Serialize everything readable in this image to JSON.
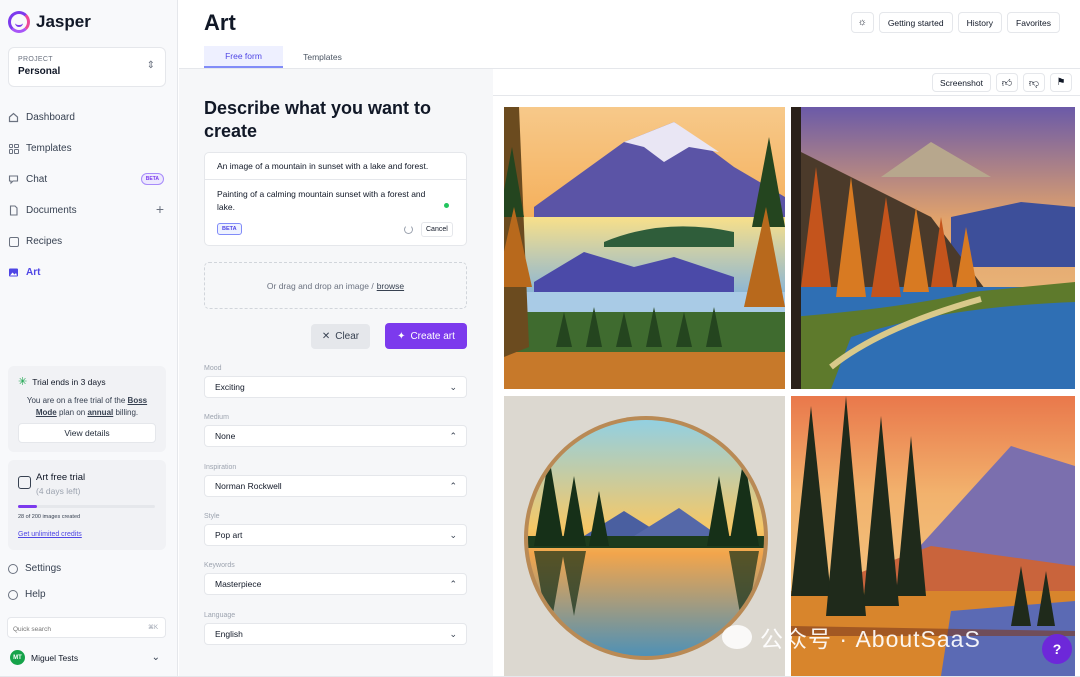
{
  "app": {
    "name": "Jasper"
  },
  "project": {
    "label": "PROJECT",
    "name": "Personal"
  },
  "nav": [
    {
      "label": "Dashboard",
      "icon": "home-icon"
    },
    {
      "label": "Templates",
      "icon": "grid-icon"
    },
    {
      "label": "Chat",
      "icon": "chat-icon",
      "badge": "BETA"
    },
    {
      "label": "Documents",
      "icon": "document-icon"
    },
    {
      "label": "Recipes",
      "icon": "recipe-icon"
    },
    {
      "label": "Art",
      "icon": "image-icon",
      "active": true
    }
  ],
  "trial": {
    "title": "Trial ends in 3 days",
    "text_before": "You are on a free trial of the ",
    "plan": "Boss Mode",
    "text_mid": " plan on ",
    "billing": "annual",
    "text_after": " billing.",
    "button": "View details"
  },
  "art_trial": {
    "title": "Art free trial",
    "subtitle": "(4 days left)",
    "count": "28 of 200 images created",
    "progress": 0.14,
    "link": "Get unlimited credits"
  },
  "bottom_nav": {
    "settings": "Settings",
    "help": "Help"
  },
  "quick_search": {
    "placeholder": "Quick search",
    "shortcut": "⌘K"
  },
  "user": {
    "initials": "MT",
    "name": "Miguel Tests"
  },
  "header": {
    "title": "Art",
    "buttons": [
      "Getting started",
      "History",
      "Favorites"
    ]
  },
  "tabs": [
    {
      "label": "Free form",
      "active": true
    },
    {
      "label": "Templates",
      "active": false
    }
  ],
  "form": {
    "title": "Describe what you want to create",
    "prompt_original": "An image of a mountain in sunset with a lake and forest.",
    "prompt_enhanced": "Painting of a calming mountain sunset with a forest and lake.",
    "beta_tag": "BETA",
    "cancel": "Cancel",
    "drop_text": "Or drag and drop an image /",
    "browse": "browse",
    "clear": "Clear",
    "create": "Create art",
    "fields": [
      {
        "label": "Mood",
        "value": "Exciting",
        "chevron": "down"
      },
      {
        "label": "Medium",
        "value": "None",
        "chevron": "up"
      },
      {
        "label": "Inspiration",
        "value": "Norman Rockwell",
        "chevron": "up"
      },
      {
        "label": "Style",
        "value": "Pop art",
        "chevron": "down"
      },
      {
        "label": "Keywords",
        "value": "Masterpiece",
        "chevron": "up"
      },
      {
        "label": "Language",
        "value": "English",
        "chevron": "down"
      }
    ]
  },
  "results": {
    "screenshot": "Screenshot"
  },
  "watermark": "公众号 · AboutSaaS",
  "help_bubble": "?",
  "colors": {
    "accent": "#7c3aed",
    "active_nav": "#4f46e5"
  }
}
